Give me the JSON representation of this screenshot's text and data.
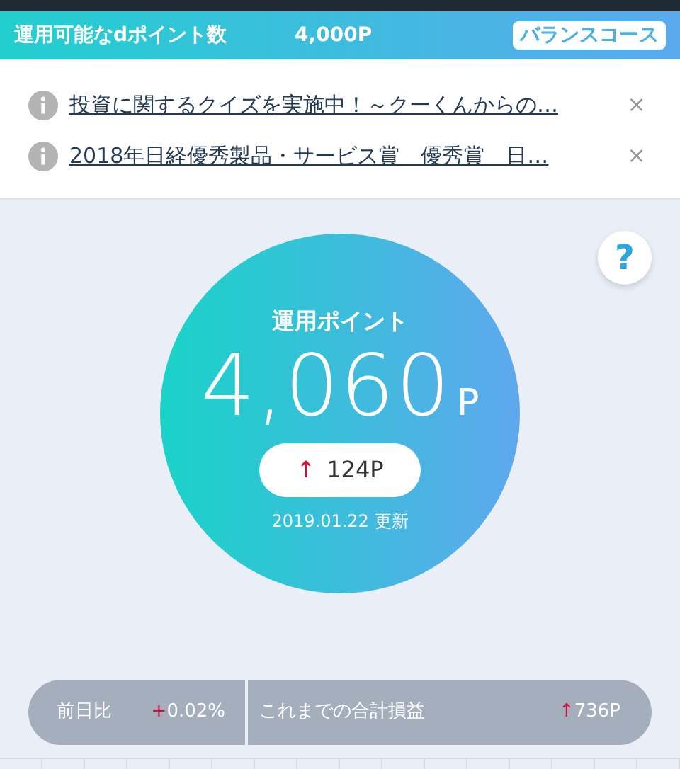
{
  "header": {
    "label": "運用可能なdポイント数",
    "value": "4,000P",
    "course": "バランスコース"
  },
  "notices": [
    {
      "text": "投資に関するクイズを実施中！～クーくんからの…",
      "close": "×"
    },
    {
      "text": "2018年日経優秀製品・サービス賞　優秀賞　日…",
      "close": "×"
    }
  ],
  "help": "?",
  "summary": {
    "title": "運用ポイント",
    "value": "4,060",
    "unit": "P",
    "change_mark": "↑",
    "change": "124P",
    "updated": "2019.01.22 更新"
  },
  "stats": [
    {
      "label": "前日比",
      "mark": "+",
      "value": "0.02%"
    },
    {
      "label": "これまでの合計損益",
      "mark": "↑",
      "value": "736P"
    }
  ]
}
